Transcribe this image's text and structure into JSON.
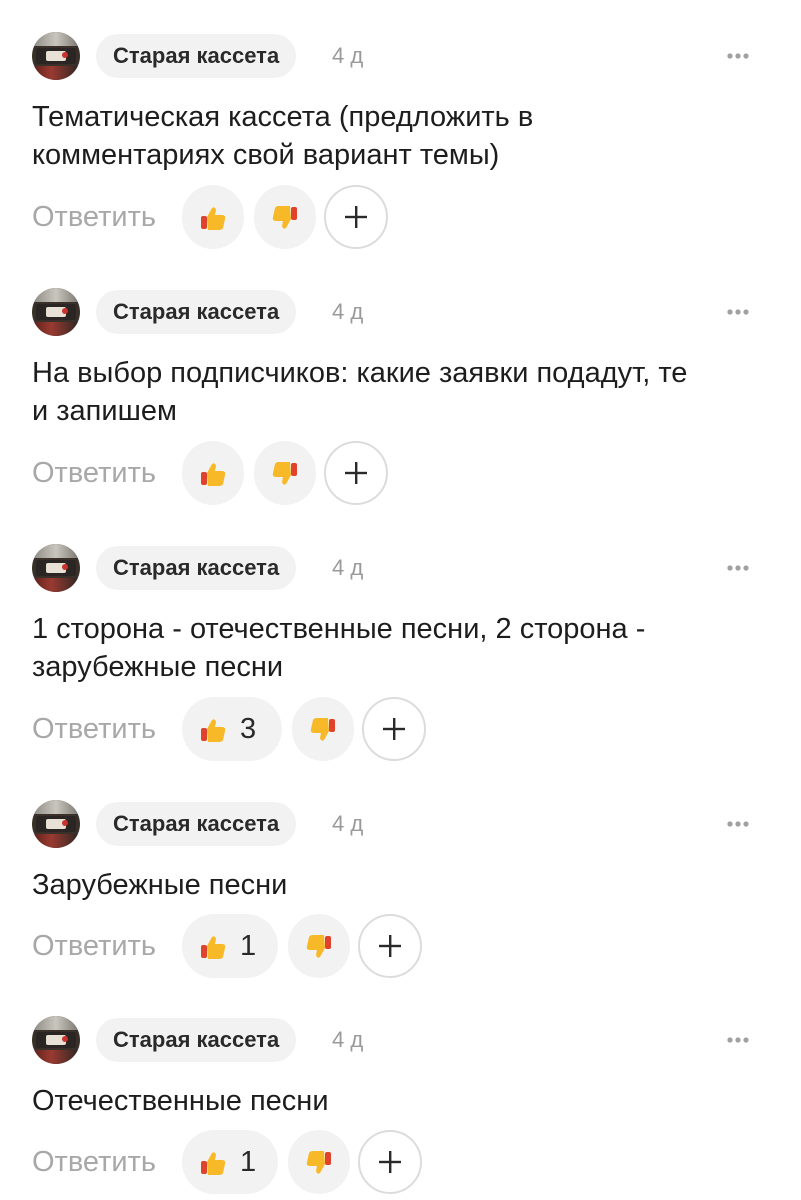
{
  "comments": [
    {
      "author": "Старая кассета",
      "time": "4 д",
      "text_lines": [
        "Тематическая кассета (предложить в",
        "комментариях свой вариант темы)"
      ],
      "reply_label": "Ответить",
      "likes": ""
    },
    {
      "author": "Старая кассета",
      "time": "4 д",
      "text_lines": [
        "На выбор подписчиков: какие заявки подадут, те",
        "и запишем"
      ],
      "reply_label": "Ответить",
      "likes": ""
    },
    {
      "author": "Старая кассета",
      "time": "4 д",
      "text_lines": [
        "1 сторона - отечественные песни, 2 сторона -",
        "зарубежные песни"
      ],
      "reply_label": "Ответить",
      "likes": "3"
    },
    {
      "author": "Старая кассета",
      "time": "4 д",
      "text_lines": [
        "Зарубежные песни"
      ],
      "reply_label": "Ответить",
      "likes": "1"
    },
    {
      "author": "Старая кассета",
      "time": "4 д",
      "text_lines": [
        "Отечественные песни"
      ],
      "reply_label": "Ответить",
      "likes": "1"
    }
  ],
  "icons": {
    "like": "thumbs-up-icon",
    "dislike": "thumbs-down-icon",
    "add": "plus-icon",
    "more": "more-dots-icon"
  },
  "colors": {
    "pill_bg": "#f2f2f2",
    "muted_text": "#a8a8a8",
    "timestamp": "#9a9a9a",
    "emoji_yellow": "#f7b928",
    "emoji_red": "#e0432b"
  }
}
